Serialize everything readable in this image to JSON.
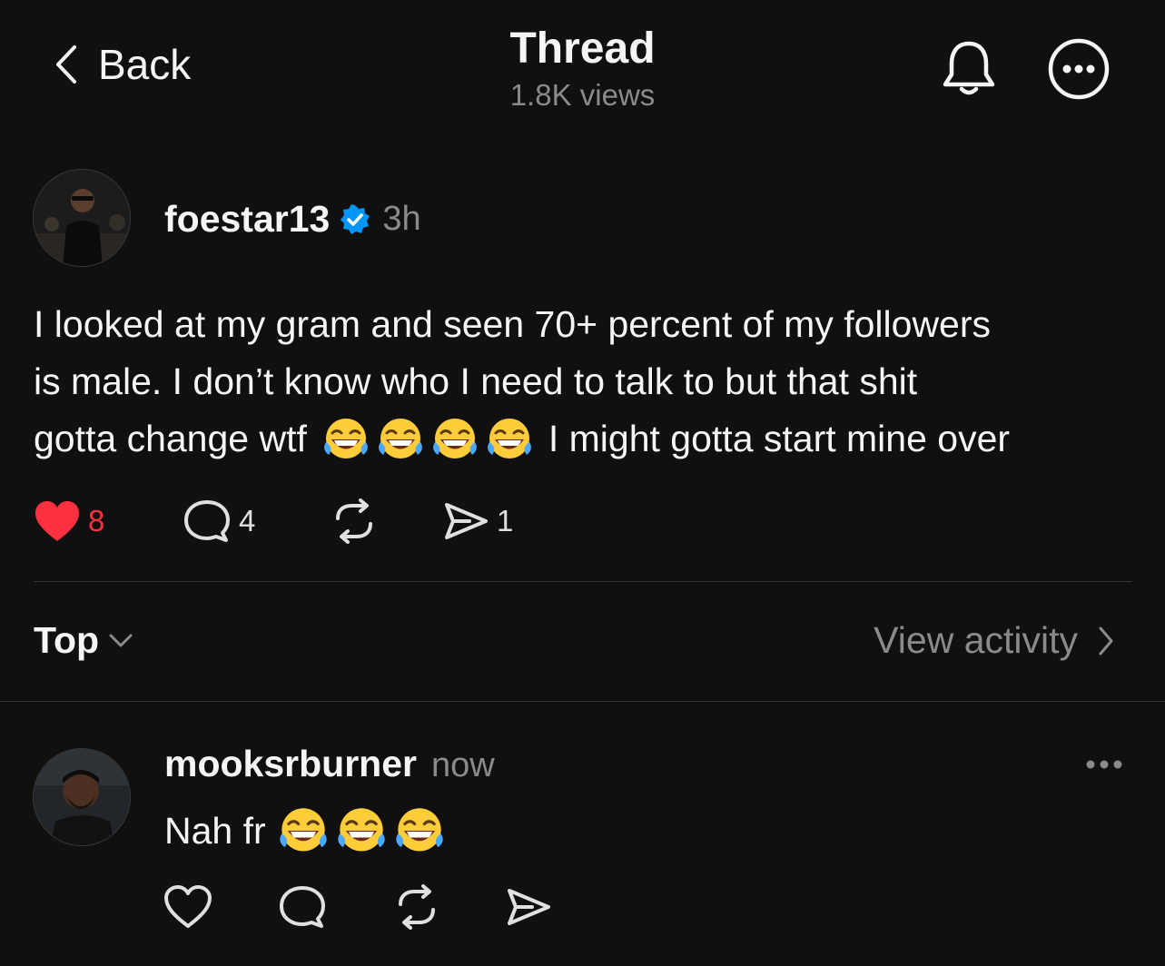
{
  "header": {
    "back_label": "Back",
    "title": "Thread",
    "views": "1.8K views",
    "icons": [
      "chevron-left-icon",
      "bell-icon",
      "more-icon"
    ]
  },
  "post": {
    "username": "foestar13",
    "verified": true,
    "time": "3h",
    "text_line1": "I looked  at my gram and seen 70+ percent of my followers",
    "text_line2": "is male. I don’t know who I need to talk to but that shit",
    "text_line3_a": "gotta change wtf",
    "text_line3_b": "I might gotta start mine over",
    "emoji_count_in_text": 4,
    "emoji": "face-with-tears-of-joy",
    "likes": "8",
    "liked": true,
    "replies": "4",
    "shares": "1",
    "accent_like_color": "#ff3040",
    "verified_color": "#0095f6"
  },
  "filter": {
    "sort_label": "Top",
    "view_activity_label": "View activity"
  },
  "reply": {
    "username": "mooksrburner",
    "time": "now",
    "text": "Nah fr",
    "emoji_count": 3,
    "icons": [
      "heart-outline-icon",
      "comment-icon",
      "repost-icon",
      "share-icon",
      "more-horizontal-icon"
    ]
  }
}
